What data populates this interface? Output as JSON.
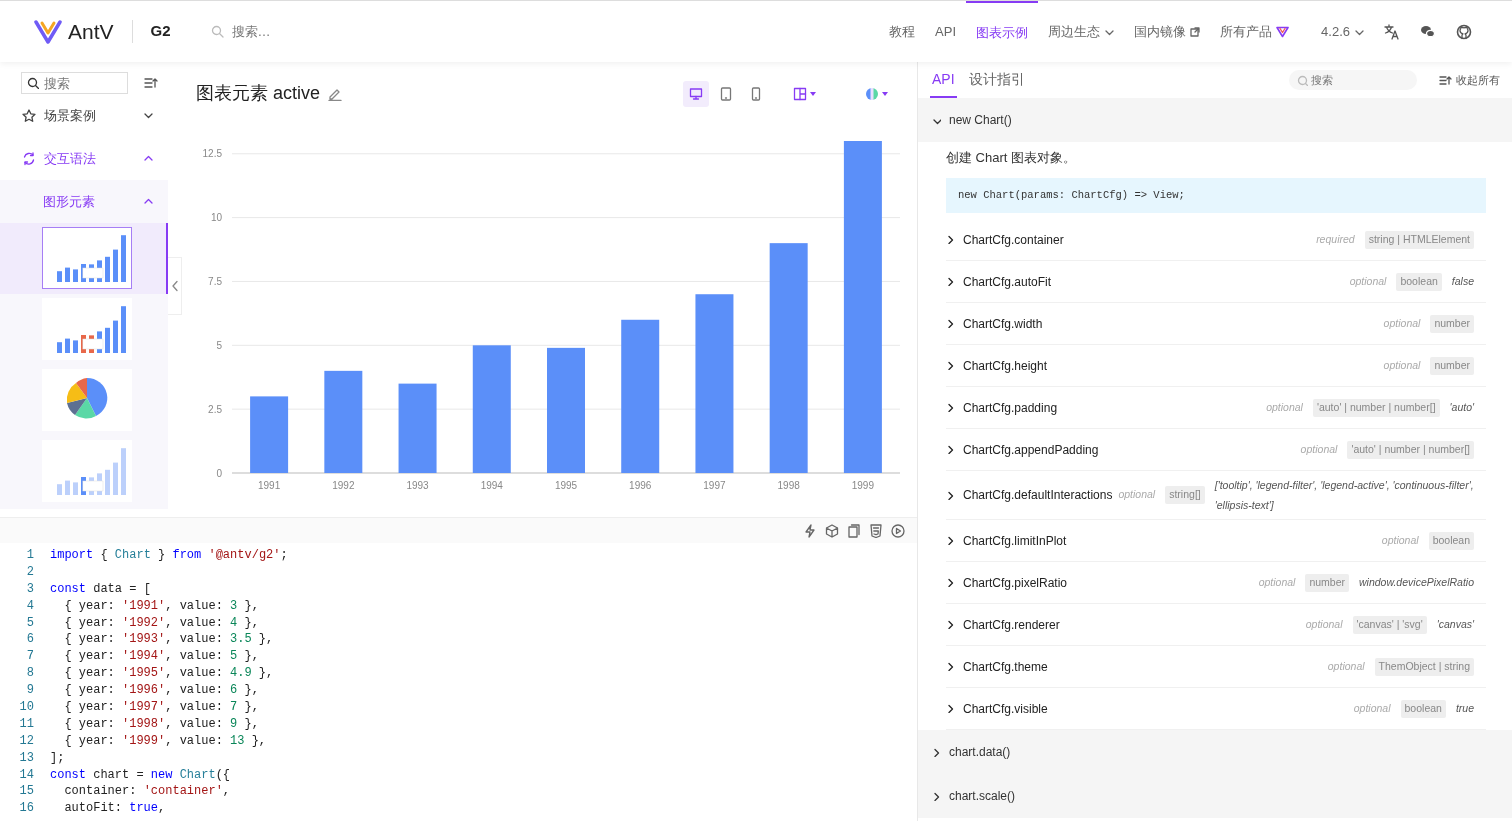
{
  "header": {
    "logo": "AntV",
    "product": "G2",
    "search": {
      "placeholder": "搜索…"
    },
    "nav": [
      {
        "label": "教程",
        "kind": "plain",
        "selected": false
      },
      {
        "label": "API",
        "kind": "plain",
        "selected": false
      },
      {
        "label": "图表示例",
        "kind": "plain",
        "selected": true
      },
      {
        "label": "周边生态",
        "kind": "dropdown",
        "selected": false
      },
      {
        "label": "国内镜像",
        "kind": "external",
        "selected": false
      },
      {
        "label": "所有产品",
        "kind": "logo",
        "selected": false
      },
      {
        "label": "4.2.6",
        "kind": "dropdown",
        "selected": false
      }
    ],
    "tools": [
      {
        "kind": "translate"
      },
      {
        "kind": "chat"
      },
      {
        "kind": "github"
      }
    ]
  },
  "sidebar": {
    "search": {
      "placeholder": "搜索"
    },
    "menu": [
      {
        "label": "场景案例",
        "kind": "star",
        "expanded": false,
        "active": false
      },
      {
        "label": "交互语法",
        "kind": "loop",
        "expanded": true,
        "active": true,
        "children": [
          {
            "label": "图形元素",
            "expanded": true,
            "active": true,
            "thumbnails": [
              {
                "kind": "bar",
                "selected": true
              },
              {
                "kind": "bar-highlight",
                "selected": false
              },
              {
                "kind": "pie",
                "selected": false
              },
              {
                "kind": "bar-faded",
                "selected": false
              }
            ]
          }
        ]
      }
    ]
  },
  "demo": {
    "title": "图表元素 active",
    "views": [
      {
        "kind": "desktop",
        "selected": true
      },
      {
        "kind": "tablet",
        "selected": false
      },
      {
        "kind": "mobile",
        "selected": false
      }
    ],
    "chart_data": {
      "type": "bar",
      "categories": [
        "1991",
        "1992",
        "1993",
        "1994",
        "1995",
        "1996",
        "1997",
        "1998",
        "1999"
      ],
      "series": [
        {
          "color": "#5b8ff9",
          "values": [
            3,
            4,
            3.5,
            5,
            4.9,
            6,
            7,
            9,
            13
          ]
        }
      ],
      "grid": true,
      "ylim": [
        0,
        13
      ],
      "yticks": [
        0,
        {
          "value": 2.5,
          "label": "2.5"
        },
        5,
        {
          "value": 7.5,
          "label": "7.5"
        },
        10,
        {
          "value": 12.5,
          "label": "12.5"
        }
      ]
    }
  },
  "editor": {
    "tools": [
      {
        "kind": "bolt"
      },
      {
        "kind": "cube"
      },
      {
        "kind": "copy"
      },
      {
        "kind": "html"
      },
      {
        "kind": "play"
      }
    ],
    "lines": [
      {
        "number": "1",
        "tokens": [
          {
            "kind": "keyword",
            "text": "import"
          },
          {
            "kind": "plain",
            "text": " { "
          },
          {
            "kind": "class",
            "text": "Chart"
          },
          {
            "kind": "plain",
            "text": " } "
          },
          {
            "kind": "keyword",
            "text": "from "
          },
          {
            "kind": "string",
            "text": "'@antv/g2'"
          },
          {
            "kind": "plain",
            "text": ";"
          }
        ]
      },
      {
        "number": "2"
      },
      {
        "number": "3",
        "tokens": [
          {
            "kind": "keyword",
            "text": "const"
          },
          {
            "kind": "plain",
            "text": " data = ["
          }
        ]
      },
      {
        "number": "4",
        "tokens": [
          {
            "kind": "plain",
            "text": "  { year: "
          },
          {
            "kind": "string",
            "text": "'1991'"
          },
          {
            "kind": "plain",
            "text": ", value: "
          },
          {
            "kind": "number",
            "text": "3"
          },
          {
            "kind": "plain",
            "text": " },"
          }
        ]
      },
      {
        "number": "5",
        "tokens": [
          {
            "kind": "plain",
            "text": "  { year: "
          },
          {
            "kind": "string",
            "text": "'1992'"
          },
          {
            "kind": "plain",
            "text": ", value: "
          },
          {
            "kind": "number",
            "text": "4"
          },
          {
            "kind": "plain",
            "text": " },"
          }
        ]
      },
      {
        "number": "6",
        "tokens": [
          {
            "kind": "plain",
            "text": "  { year: "
          },
          {
            "kind": "string",
            "text": "'1993'"
          },
          {
            "kind": "plain",
            "text": ", value: "
          },
          {
            "kind": "number",
            "text": "3.5"
          },
          {
            "kind": "plain",
            "text": " },"
          }
        ]
      },
      {
        "number": "7",
        "tokens": [
          {
            "kind": "plain",
            "text": "  { year: "
          },
          {
            "kind": "string",
            "text": "'1994'"
          },
          {
            "kind": "plain",
            "text": ", value: "
          },
          {
            "kind": "number",
            "text": "5"
          },
          {
            "kind": "plain",
            "text": " },"
          }
        ]
      },
      {
        "number": "8",
        "tokens": [
          {
            "kind": "plain",
            "text": "  { year: "
          },
          {
            "kind": "string",
            "text": "'1995'"
          },
          {
            "kind": "plain",
            "text": ", value: "
          },
          {
            "kind": "number",
            "text": "4.9"
          },
          {
            "kind": "plain",
            "text": " },"
          }
        ]
      },
      {
        "number": "9",
        "tokens": [
          {
            "kind": "plain",
            "text": "  { year: "
          },
          {
            "kind": "string",
            "text": "'1996'"
          },
          {
            "kind": "plain",
            "text": ", value: "
          },
          {
            "kind": "number",
            "text": "6"
          },
          {
            "kind": "plain",
            "text": " },"
          }
        ]
      },
      {
        "number": "10",
        "tokens": [
          {
            "kind": "plain",
            "text": "  { year: "
          },
          {
            "kind": "string",
            "text": "'1997'"
          },
          {
            "kind": "plain",
            "text": ", value: "
          },
          {
            "kind": "number",
            "text": "7"
          },
          {
            "kind": "plain",
            "text": " },"
          }
        ]
      },
      {
        "number": "11",
        "tokens": [
          {
            "kind": "plain",
            "text": "  { year: "
          },
          {
            "kind": "string",
            "text": "'1998'"
          },
          {
            "kind": "plain",
            "text": ", value: "
          },
          {
            "kind": "number",
            "text": "9"
          },
          {
            "kind": "plain",
            "text": " },"
          }
        ]
      },
      {
        "number": "12",
        "tokens": [
          {
            "kind": "plain",
            "text": "  { year: "
          },
          {
            "kind": "string",
            "text": "'1999'"
          },
          {
            "kind": "plain",
            "text": ", value: "
          },
          {
            "kind": "number",
            "text": "13"
          },
          {
            "kind": "plain",
            "text": " },"
          }
        ]
      },
      {
        "number": "13",
        "tokens": [
          {
            "kind": "plain",
            "text": "];"
          }
        ]
      },
      {
        "number": "14",
        "tokens": [
          {
            "kind": "keyword",
            "text": "const"
          },
          {
            "kind": "plain",
            "text": " chart = "
          },
          {
            "kind": "keyword",
            "text": "new "
          },
          {
            "kind": "class",
            "text": "Chart"
          },
          {
            "kind": "plain",
            "text": "({"
          }
        ]
      },
      {
        "number": "15",
        "tokens": [
          {
            "kind": "plain",
            "text": "  container: "
          },
          {
            "kind": "string",
            "text": "'container'"
          },
          {
            "kind": "plain",
            "text": ","
          }
        ]
      },
      {
        "number": "16",
        "tokens": [
          {
            "kind": "plain",
            "text": "  autoFit: "
          },
          {
            "kind": "keyword",
            "text": "true"
          },
          {
            "kind": "plain",
            "text": ","
          }
        ]
      }
    ]
  },
  "docs": {
    "tabs": [
      {
        "label": "API",
        "selected": true
      },
      {
        "label": "设计指引",
        "selected": false
      }
    ],
    "search": {
      "placeholder": "搜索"
    },
    "collapse_all": "收起所有",
    "sections": [
      {
        "title": "new Chart()",
        "expanded": true,
        "description": "创建 Chart 图表对象。",
        "signature": "new Chart(params: ChartCfg) => View;",
        "params": [
          {
            "name": "ChartCfg.container",
            "requirement": "required",
            "type": "string | HTMLElement"
          },
          {
            "name": "ChartCfg.autoFit",
            "requirement": "optional",
            "type": "boolean",
            "default": "false"
          },
          {
            "name": "ChartCfg.width",
            "requirement": "optional",
            "type": "number"
          },
          {
            "name": "ChartCfg.height",
            "requirement": "optional",
            "type": "number"
          },
          {
            "name": "ChartCfg.padding",
            "requirement": "optional",
            "type": "'auto' | number | number[]",
            "default": "'auto'"
          },
          {
            "name": "ChartCfg.appendPadding",
            "requirement": "optional",
            "type": "'auto' | number | number[]"
          },
          {
            "name": "ChartCfg.defaultInteractions",
            "requirement": "optional",
            "type": "string[]",
            "default": "['tooltip', 'legend-filter', 'legend-active', 'continuous-filter', 'ellipsis-text']"
          },
          {
            "name": "ChartCfg.limitInPlot",
            "requirement": "optional",
            "type": "boolean"
          },
          {
            "name": "ChartCfg.pixelRatio",
            "requirement": "optional",
            "type": "number",
            "default": "window.devicePixelRatio"
          },
          {
            "name": "ChartCfg.renderer",
            "requirement": "optional",
            "type": "'canvas' | 'svg'",
            "default": "'canvas'"
          },
          {
            "name": "ChartCfg.theme",
            "requirement": "optional",
            "type": "ThemObject | string"
          },
          {
            "name": "ChartCfg.visible",
            "requirement": "optional",
            "type": "boolean",
            "default": "true"
          }
        ]
      },
      {
        "title": "chart.data()",
        "expanded": false
      },
      {
        "title": "chart.scale()",
        "expanded": false
      }
    ]
  }
}
